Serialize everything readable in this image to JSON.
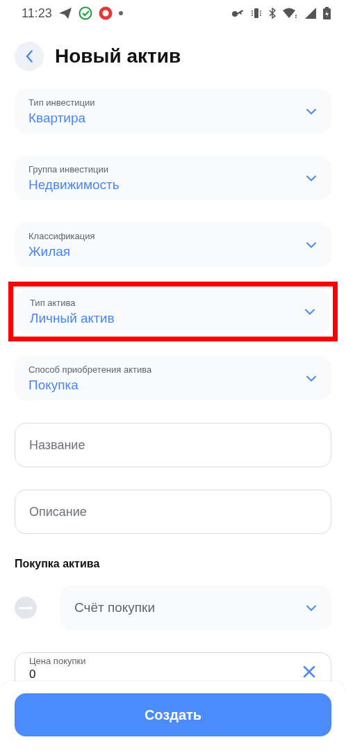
{
  "status_bar": {
    "time": "11:23"
  },
  "header": {
    "title": "Новый актив"
  },
  "fields": [
    {
      "kind": "select",
      "label": "Тип инвестиции",
      "value": "Квартира",
      "highlighted": false
    },
    {
      "kind": "select",
      "label": "Группа инвестиции",
      "value": "Недвижимость",
      "highlighted": false
    },
    {
      "kind": "select",
      "label": "Классификация",
      "value": "Жилая",
      "highlighted": false
    },
    {
      "kind": "select",
      "label": "Тип актива",
      "value": "Личный актив",
      "highlighted": true
    },
    {
      "kind": "select",
      "label": "Способ приобретения актива",
      "value": "Покупка",
      "highlighted": false
    },
    {
      "kind": "input",
      "placeholder": "Название"
    },
    {
      "kind": "input",
      "placeholder": "Описание"
    }
  ],
  "purchase": {
    "title": "Покупка актива",
    "account": {
      "placeholder": "Счёт покупки"
    },
    "price": {
      "label": "Цена покупки",
      "value": "0"
    }
  },
  "submit_button": "Создать"
}
